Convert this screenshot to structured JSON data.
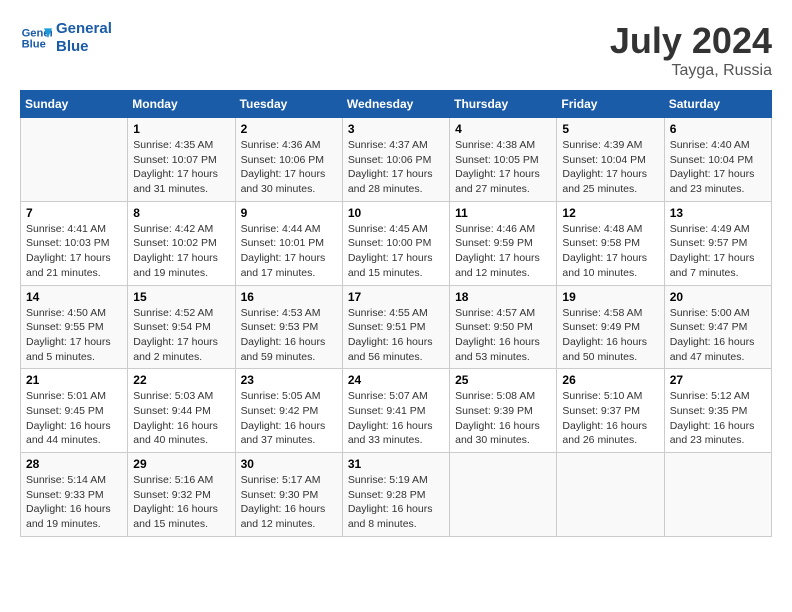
{
  "header": {
    "logo_line1": "General",
    "logo_line2": "Blue",
    "month": "July 2024",
    "location": "Tayga, Russia"
  },
  "weekdays": [
    "Sunday",
    "Monday",
    "Tuesday",
    "Wednesday",
    "Thursday",
    "Friday",
    "Saturday"
  ],
  "weeks": [
    [
      {
        "day": "",
        "sunrise": "",
        "sunset": "",
        "daylight": ""
      },
      {
        "day": "1",
        "sunrise": "4:35 AM",
        "sunset": "10:07 PM",
        "daylight": "17 hours and 31 minutes."
      },
      {
        "day": "2",
        "sunrise": "4:36 AM",
        "sunset": "10:06 PM",
        "daylight": "17 hours and 30 minutes."
      },
      {
        "day": "3",
        "sunrise": "4:37 AM",
        "sunset": "10:06 PM",
        "daylight": "17 hours and 28 minutes."
      },
      {
        "day": "4",
        "sunrise": "4:38 AM",
        "sunset": "10:05 PM",
        "daylight": "17 hours and 27 minutes."
      },
      {
        "day": "5",
        "sunrise": "4:39 AM",
        "sunset": "10:04 PM",
        "daylight": "17 hours and 25 minutes."
      },
      {
        "day": "6",
        "sunrise": "4:40 AM",
        "sunset": "10:04 PM",
        "daylight": "17 hours and 23 minutes."
      }
    ],
    [
      {
        "day": "7",
        "sunrise": "4:41 AM",
        "sunset": "10:03 PM",
        "daylight": "17 hours and 21 minutes."
      },
      {
        "day": "8",
        "sunrise": "4:42 AM",
        "sunset": "10:02 PM",
        "daylight": "17 hours and 19 minutes."
      },
      {
        "day": "9",
        "sunrise": "4:44 AM",
        "sunset": "10:01 PM",
        "daylight": "17 hours and 17 minutes."
      },
      {
        "day": "10",
        "sunrise": "4:45 AM",
        "sunset": "10:00 PM",
        "daylight": "17 hours and 15 minutes."
      },
      {
        "day": "11",
        "sunrise": "4:46 AM",
        "sunset": "9:59 PM",
        "daylight": "17 hours and 12 minutes."
      },
      {
        "day": "12",
        "sunrise": "4:48 AM",
        "sunset": "9:58 PM",
        "daylight": "17 hours and 10 minutes."
      },
      {
        "day": "13",
        "sunrise": "4:49 AM",
        "sunset": "9:57 PM",
        "daylight": "17 hours and 7 minutes."
      }
    ],
    [
      {
        "day": "14",
        "sunrise": "4:50 AM",
        "sunset": "9:55 PM",
        "daylight": "17 hours and 5 minutes."
      },
      {
        "day": "15",
        "sunrise": "4:52 AM",
        "sunset": "9:54 PM",
        "daylight": "17 hours and 2 minutes."
      },
      {
        "day": "16",
        "sunrise": "4:53 AM",
        "sunset": "9:53 PM",
        "daylight": "16 hours and 59 minutes."
      },
      {
        "day": "17",
        "sunrise": "4:55 AM",
        "sunset": "9:51 PM",
        "daylight": "16 hours and 56 minutes."
      },
      {
        "day": "18",
        "sunrise": "4:57 AM",
        "sunset": "9:50 PM",
        "daylight": "16 hours and 53 minutes."
      },
      {
        "day": "19",
        "sunrise": "4:58 AM",
        "sunset": "9:49 PM",
        "daylight": "16 hours and 50 minutes."
      },
      {
        "day": "20",
        "sunrise": "5:00 AM",
        "sunset": "9:47 PM",
        "daylight": "16 hours and 47 minutes."
      }
    ],
    [
      {
        "day": "21",
        "sunrise": "5:01 AM",
        "sunset": "9:45 PM",
        "daylight": "16 hours and 44 minutes."
      },
      {
        "day": "22",
        "sunrise": "5:03 AM",
        "sunset": "9:44 PM",
        "daylight": "16 hours and 40 minutes."
      },
      {
        "day": "23",
        "sunrise": "5:05 AM",
        "sunset": "9:42 PM",
        "daylight": "16 hours and 37 minutes."
      },
      {
        "day": "24",
        "sunrise": "5:07 AM",
        "sunset": "9:41 PM",
        "daylight": "16 hours and 33 minutes."
      },
      {
        "day": "25",
        "sunrise": "5:08 AM",
        "sunset": "9:39 PM",
        "daylight": "16 hours and 30 minutes."
      },
      {
        "day": "26",
        "sunrise": "5:10 AM",
        "sunset": "9:37 PM",
        "daylight": "16 hours and 26 minutes."
      },
      {
        "day": "27",
        "sunrise": "5:12 AM",
        "sunset": "9:35 PM",
        "daylight": "16 hours and 23 minutes."
      }
    ],
    [
      {
        "day": "28",
        "sunrise": "5:14 AM",
        "sunset": "9:33 PM",
        "daylight": "16 hours and 19 minutes."
      },
      {
        "day": "29",
        "sunrise": "5:16 AM",
        "sunset": "9:32 PM",
        "daylight": "16 hours and 15 minutes."
      },
      {
        "day": "30",
        "sunrise": "5:17 AM",
        "sunset": "9:30 PM",
        "daylight": "16 hours and 12 minutes."
      },
      {
        "day": "31",
        "sunrise": "5:19 AM",
        "sunset": "9:28 PM",
        "daylight": "16 hours and 8 minutes."
      },
      {
        "day": "",
        "sunrise": "",
        "sunset": "",
        "daylight": ""
      },
      {
        "day": "",
        "sunrise": "",
        "sunset": "",
        "daylight": ""
      },
      {
        "day": "",
        "sunrise": "",
        "sunset": "",
        "daylight": ""
      }
    ]
  ]
}
